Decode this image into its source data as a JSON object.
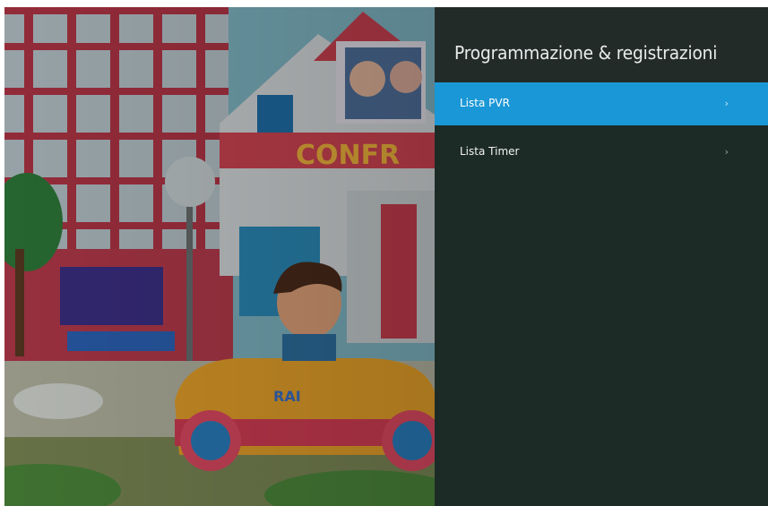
{
  "panel": {
    "title": "Programmazione & registrazioni",
    "items": [
      {
        "label": "Lista PVR",
        "selected": true,
        "chevron": "›"
      },
      {
        "label": "Lista Timer",
        "selected": false,
        "chevron": "›"
      }
    ]
  },
  "colors": {
    "panel_bg": "#1d2b26",
    "header_bg": "#232b29",
    "selected": "#1a97d6"
  },
  "icons": [
    "chevron-right-icon"
  ]
}
